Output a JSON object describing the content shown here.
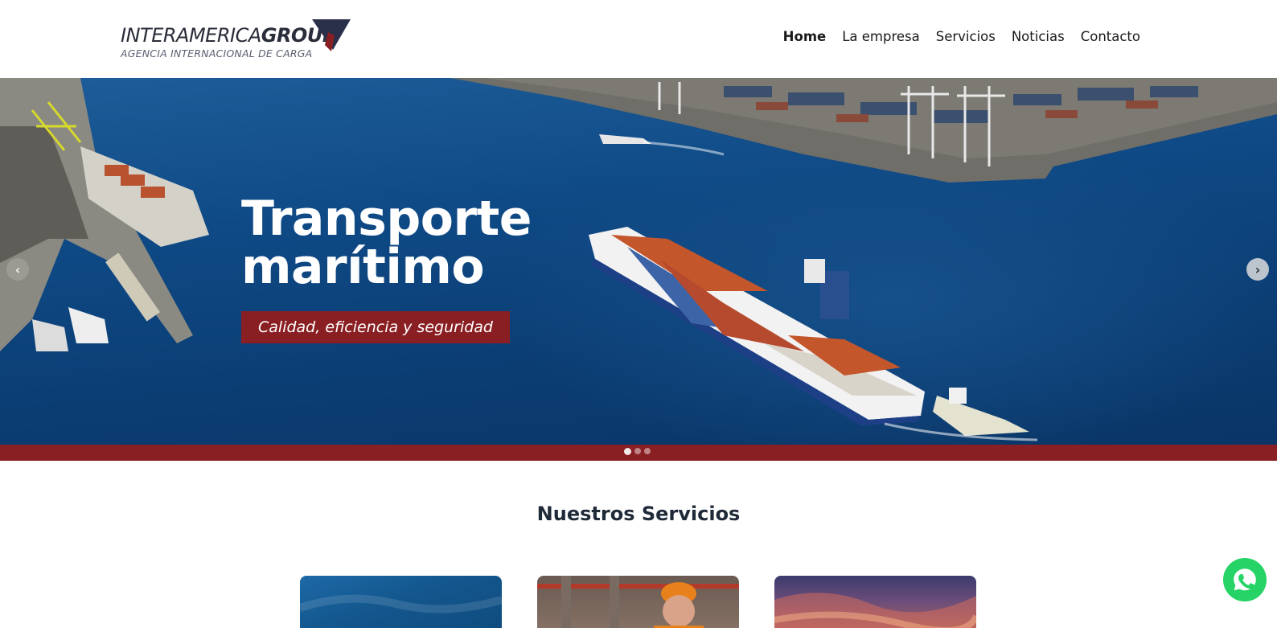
{
  "brand": {
    "name_light": "INTERAMERICA",
    "name_bold": "GROUP",
    "tagline": "AGENCIA INTERNACIONAL DE CARGA"
  },
  "nav": {
    "items": [
      {
        "label": "Home",
        "active": true
      },
      {
        "label": "La empresa",
        "active": false
      },
      {
        "label": "Servicios",
        "active": false
      },
      {
        "label": "Noticias",
        "active": false
      },
      {
        "label": "Contacto",
        "active": false
      }
    ]
  },
  "hero": {
    "title_line1": "Transporte",
    "title_line2": "marítimo",
    "tagline": "Calidad, eficiencia y seguridad",
    "prev_icon": "chevron-left-icon",
    "next_icon": "chevron-right-icon",
    "slides_count": 3,
    "active_slide": 1
  },
  "services": {
    "title_light": "Nuestros",
    "title_bold": "Servicios"
  },
  "colors": {
    "brand_red": "#8a1f23",
    "whatsapp_green": "#25d366",
    "sea_blue": "#0f4a86"
  },
  "floating": {
    "whatsapp_icon": "whatsapp-icon"
  }
}
